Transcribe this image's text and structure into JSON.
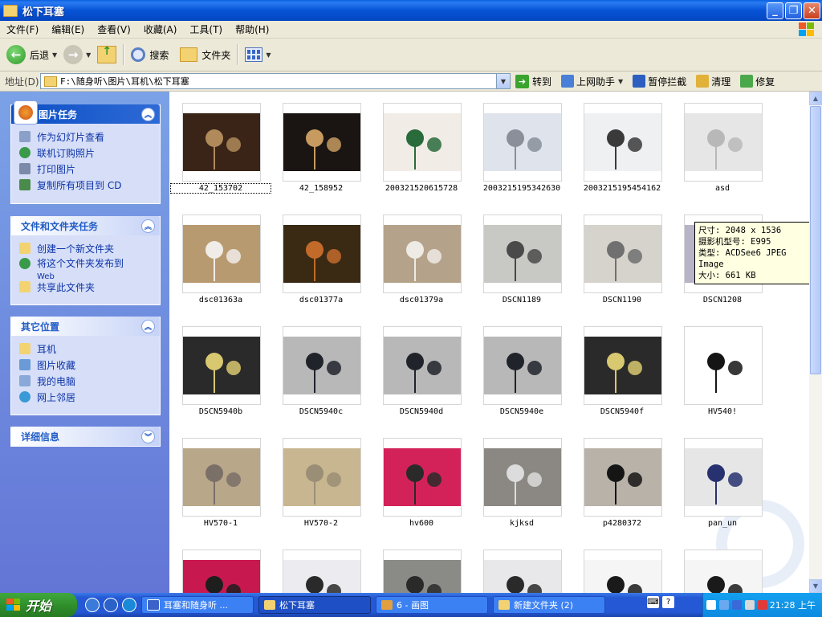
{
  "window": {
    "title": "松下耳塞"
  },
  "menu": [
    "文件(F)",
    "编辑(E)",
    "查看(V)",
    "收藏(A)",
    "工具(T)",
    "帮助(H)"
  ],
  "toolbar": {
    "back": "后退",
    "search": "搜索",
    "folders": "文件夹"
  },
  "address": {
    "label": "地址(D)",
    "path": "F:\\随身听\\图片\\耳机\\松下耳塞",
    "go": "转到",
    "buttons": [
      "上网助手",
      "暂停拦截",
      "清理",
      "修复"
    ]
  },
  "left": {
    "picture_tasks": {
      "title": "图片任务",
      "items": [
        "作为幻灯片查看",
        "联机订购照片",
        "打印图片",
        "复制所有项目到 CD"
      ]
    },
    "file_tasks": {
      "title": "文件和文件夹任务",
      "items": [
        "创建一个新文件夹",
        "将这个文件夹发布到",
        "共享此文件夹"
      ],
      "web": "Web"
    },
    "other_places": {
      "title": "其它位置",
      "items": [
        "耳机",
        "图片收藏",
        "我的电脑",
        "网上邻居"
      ]
    },
    "details": {
      "title": "详细信息"
    }
  },
  "files": [
    {
      "name": "42_153702",
      "bg": "#3a2418",
      "fg": "#b08a5a"
    },
    {
      "name": "42_158952",
      "bg": "#1a1512",
      "fg": "#c79a60"
    },
    {
      "name": "200321520615728",
      "bg": "#f1ece6",
      "fg": "#2a6b3b"
    },
    {
      "name": "2003215195342630",
      "bg": "#dfe4ec",
      "fg": "#8a8f9a"
    },
    {
      "name": "2003215195454162",
      "bg": "#eef0f2",
      "fg": "#3a3a3a"
    },
    {
      "name": "asd",
      "bg": "#e6e6e6",
      "fg": "#b8b8b8"
    },
    {
      "name": "dsc01363a",
      "bg": "#b89a70",
      "fg": "#f0ece8"
    },
    {
      "name": "dsc01377a",
      "bg": "#3a2a14",
      "fg": "#c26a2a"
    },
    {
      "name": "dsc01379a",
      "bg": "#b5a28a",
      "fg": "#eeeae4"
    },
    {
      "name": "DSCN1189",
      "bg": "#c8c8c4",
      "fg": "#4a4a4a"
    },
    {
      "name": "DSCN1190",
      "bg": "#d6d2cc",
      "fg": "#707070"
    },
    {
      "name": "DSCN1208",
      "bg": "#b9b3c7",
      "fg": "#6a6470"
    },
    {
      "name": "DSCN5940b",
      "bg": "#2a2a2a",
      "fg": "#d8c870"
    },
    {
      "name": "DSCN5940c",
      "bg": "#b8b8b8",
      "fg": "#20232a"
    },
    {
      "name": "DSCN5940d",
      "bg": "#b8b8b8",
      "fg": "#20232a"
    },
    {
      "name": "DSCN5940e",
      "bg": "#b8b8b8",
      "fg": "#20232a"
    },
    {
      "name": "DSCN5940f",
      "bg": "#2a2a2a",
      "fg": "#d8c870"
    },
    {
      "name": "HV540!",
      "bg": "#ffffff",
      "fg": "#151515"
    },
    {
      "name": "HV570-1",
      "bg": "#b9a789",
      "fg": "#7a7068"
    },
    {
      "name": "HV570-2",
      "bg": "#c8b690",
      "fg": "#9a8e76"
    },
    {
      "name": "hv600",
      "bg": "#d3225a",
      "fg": "#2a2a2a"
    },
    {
      "name": "kjksd",
      "bg": "#8b8883",
      "fg": "#dcdcdc"
    },
    {
      "name": "p4280372",
      "bg": "#b8b2a8",
      "fg": "#151515"
    },
    {
      "name": "pan_un",
      "bg": "#e6e6e6",
      "fg": "#27316f"
    },
    {
      "name": "",
      "bg": "#c81850",
      "fg": "#1e1e1e"
    },
    {
      "name": "",
      "bg": "#ececf0",
      "fg": "#2a2a2a"
    },
    {
      "name": "",
      "bg": "#8a8a86",
      "fg": "#2a2a2a"
    },
    {
      "name": "",
      "bg": "#e8e8ea",
      "fg": "#2a2a2a"
    },
    {
      "name": "",
      "bg": "#f5f5f5",
      "fg": "#1a1a1a"
    },
    {
      "name": "",
      "bg": "#f5f5f5",
      "fg": "#1a1a1a"
    }
  ],
  "tooltip": [
    "尺寸: 2048 x 1536",
    "摄影机型号: E995",
    "类型: ACDSee6 JPEG Image",
    "大小: 661 KB"
  ],
  "taskbar": {
    "start": "开始",
    "tasks": [
      "耳塞和随身听 ...",
      "松下耳塞",
      "6 - 画图",
      "新建文件夹 (2)"
    ],
    "clock": "21:28 上午"
  },
  "colors": {
    "xp_blue": "#0653d6",
    "task_link": "#0c32a8",
    "panel": "#d6dff7"
  }
}
